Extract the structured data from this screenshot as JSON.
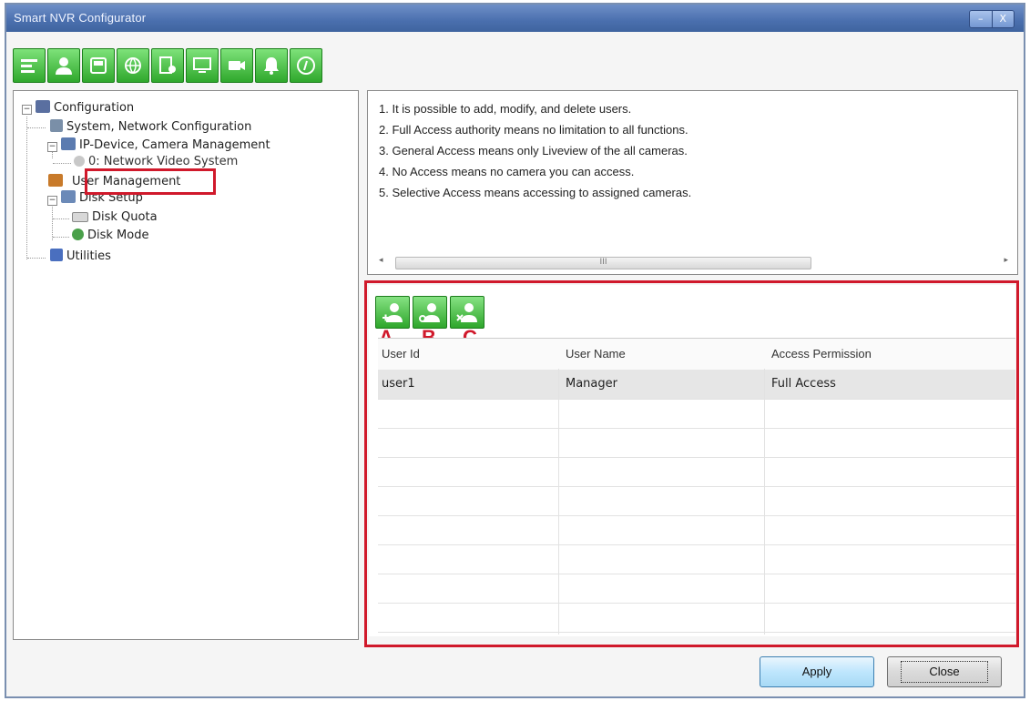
{
  "window": {
    "title": "Smart NVR Configurator",
    "minimize_glyph": "–",
    "close_glyph": "X"
  },
  "toolbar": {
    "icons": [
      "config-icon",
      "user-icon",
      "disk-icon",
      "network-icon",
      "device-icon",
      "monitor-icon",
      "camera-icon",
      "alarm-bell-icon",
      "info-icon"
    ]
  },
  "tree": {
    "root": "Configuration",
    "items": [
      {
        "label": "System, Network Configuration"
      },
      {
        "label": "IP-Device, Camera Management"
      },
      {
        "label": "0: Network Video System"
      },
      {
        "label": "User Management"
      },
      {
        "label": "Disk Setup"
      },
      {
        "label": "Disk Quota"
      },
      {
        "label": "Disk Mode"
      },
      {
        "label": "Utilities"
      }
    ]
  },
  "info": {
    "lines": [
      "1. It is possible to add, modify, and delete users.",
      "2. Full Access authority means no limitation to all functions.",
      "3. General Access means only Liveview of the all cameras.",
      "4. No Access means no camera you can access.",
      "5. Selective Access means accessing to assigned cameras."
    ],
    "scroll_thumb": "III"
  },
  "user_tools": {
    "labels": [
      "A",
      "B",
      "C"
    ],
    "icons": [
      "add-user-icon",
      "edit-user-icon",
      "delete-user-icon"
    ]
  },
  "users_table": {
    "columns": [
      "User Id",
      "User Name",
      "Access Permission"
    ],
    "rows": [
      {
        "id": "user1",
        "name": "Manager",
        "permission": "Full Access"
      }
    ]
  },
  "buttons": {
    "apply": "Apply",
    "close": "Close"
  },
  "colors": {
    "highlight": "#d0192b",
    "toolbar_green": "#2fa82c",
    "titlebar": "#4a6fae"
  }
}
